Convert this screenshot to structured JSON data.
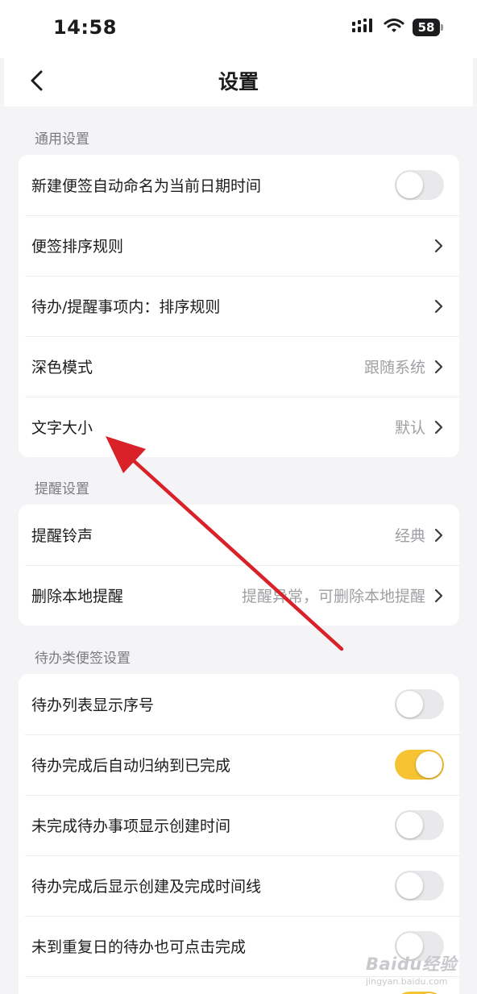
{
  "status_bar": {
    "time": "14:58",
    "battery": "58"
  },
  "nav": {
    "title": "设置"
  },
  "sections": [
    {
      "header": "通用设置",
      "rows": [
        {
          "label": "新建便签自动命名为当前日期时间",
          "control": "toggle",
          "on": false
        },
        {
          "label": "便签排序规则",
          "control": "chevron"
        },
        {
          "label": "待办/提醒事项内：排序规则",
          "control": "chevron"
        },
        {
          "label": "深色模式",
          "value": "跟随系统",
          "control": "chevron"
        },
        {
          "label": "文字大小",
          "value": "默认",
          "control": "chevron"
        }
      ]
    },
    {
      "header": "提醒设置",
      "rows": [
        {
          "label": "提醒铃声",
          "value": "经典",
          "control": "chevron"
        },
        {
          "label": "删除本地提醒",
          "value": "提醒异常，可删除本地提醒",
          "control": "chevron"
        }
      ]
    },
    {
      "header": "待办类便签设置",
      "rows": [
        {
          "label": "待办列表显示序号",
          "control": "toggle",
          "on": false
        },
        {
          "label": "待办完成后自动归纳到已完成",
          "control": "toggle",
          "on": true
        },
        {
          "label": "未完成待办事项显示创建时间",
          "control": "toggle",
          "on": false
        },
        {
          "label": "待办完成后显示创建及完成时间线",
          "control": "toggle",
          "on": false
        },
        {
          "label": "未到重复日的待办也可点击完成",
          "control": "toggle",
          "on": false
        },
        {
          "label": "",
          "control": "toggle",
          "on": true
        }
      ]
    }
  ],
  "colors": {
    "accent": "#f6c333",
    "annotation_arrow": "#d9212a"
  },
  "watermark": {
    "logo": "Baidu经验",
    "url": "jingyan.baidu.com"
  }
}
